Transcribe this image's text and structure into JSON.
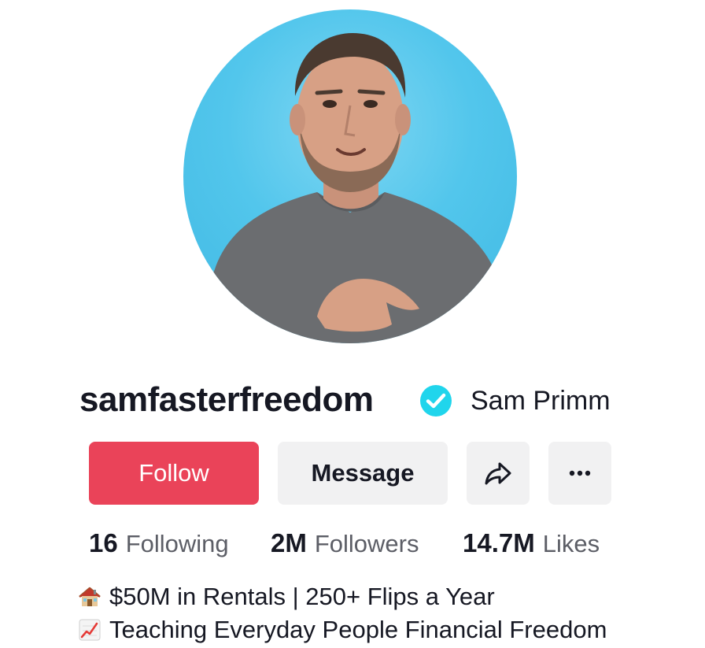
{
  "profile": {
    "username": "samfasterfreedom",
    "display_name": "Sam Primm",
    "verified": true,
    "avatar_desc": "profile-photo"
  },
  "actions": {
    "follow_label": "Follow",
    "message_label": "Message",
    "share_icon": "share-arrow-icon",
    "more_icon": "more-dots-icon"
  },
  "stats": [
    {
      "value": "16",
      "label": "Following"
    },
    {
      "value": "2M",
      "label": "Followers"
    },
    {
      "value": "14.7M",
      "label": "Likes"
    }
  ],
  "bio": {
    "line1": {
      "icon": "house-icon",
      "text": "$50M in Rentals | 250+ Flips a Year"
    },
    "line2": {
      "icon": "chart-increasing-icon",
      "text": "Teaching Everyday People Financial Freedom"
    }
  },
  "colors": {
    "follow_bg": "#ea4359",
    "secondary_bg": "#f1f1f2",
    "verified": "#20d5ec",
    "text": "#161823",
    "muted": "#5c5e66"
  }
}
